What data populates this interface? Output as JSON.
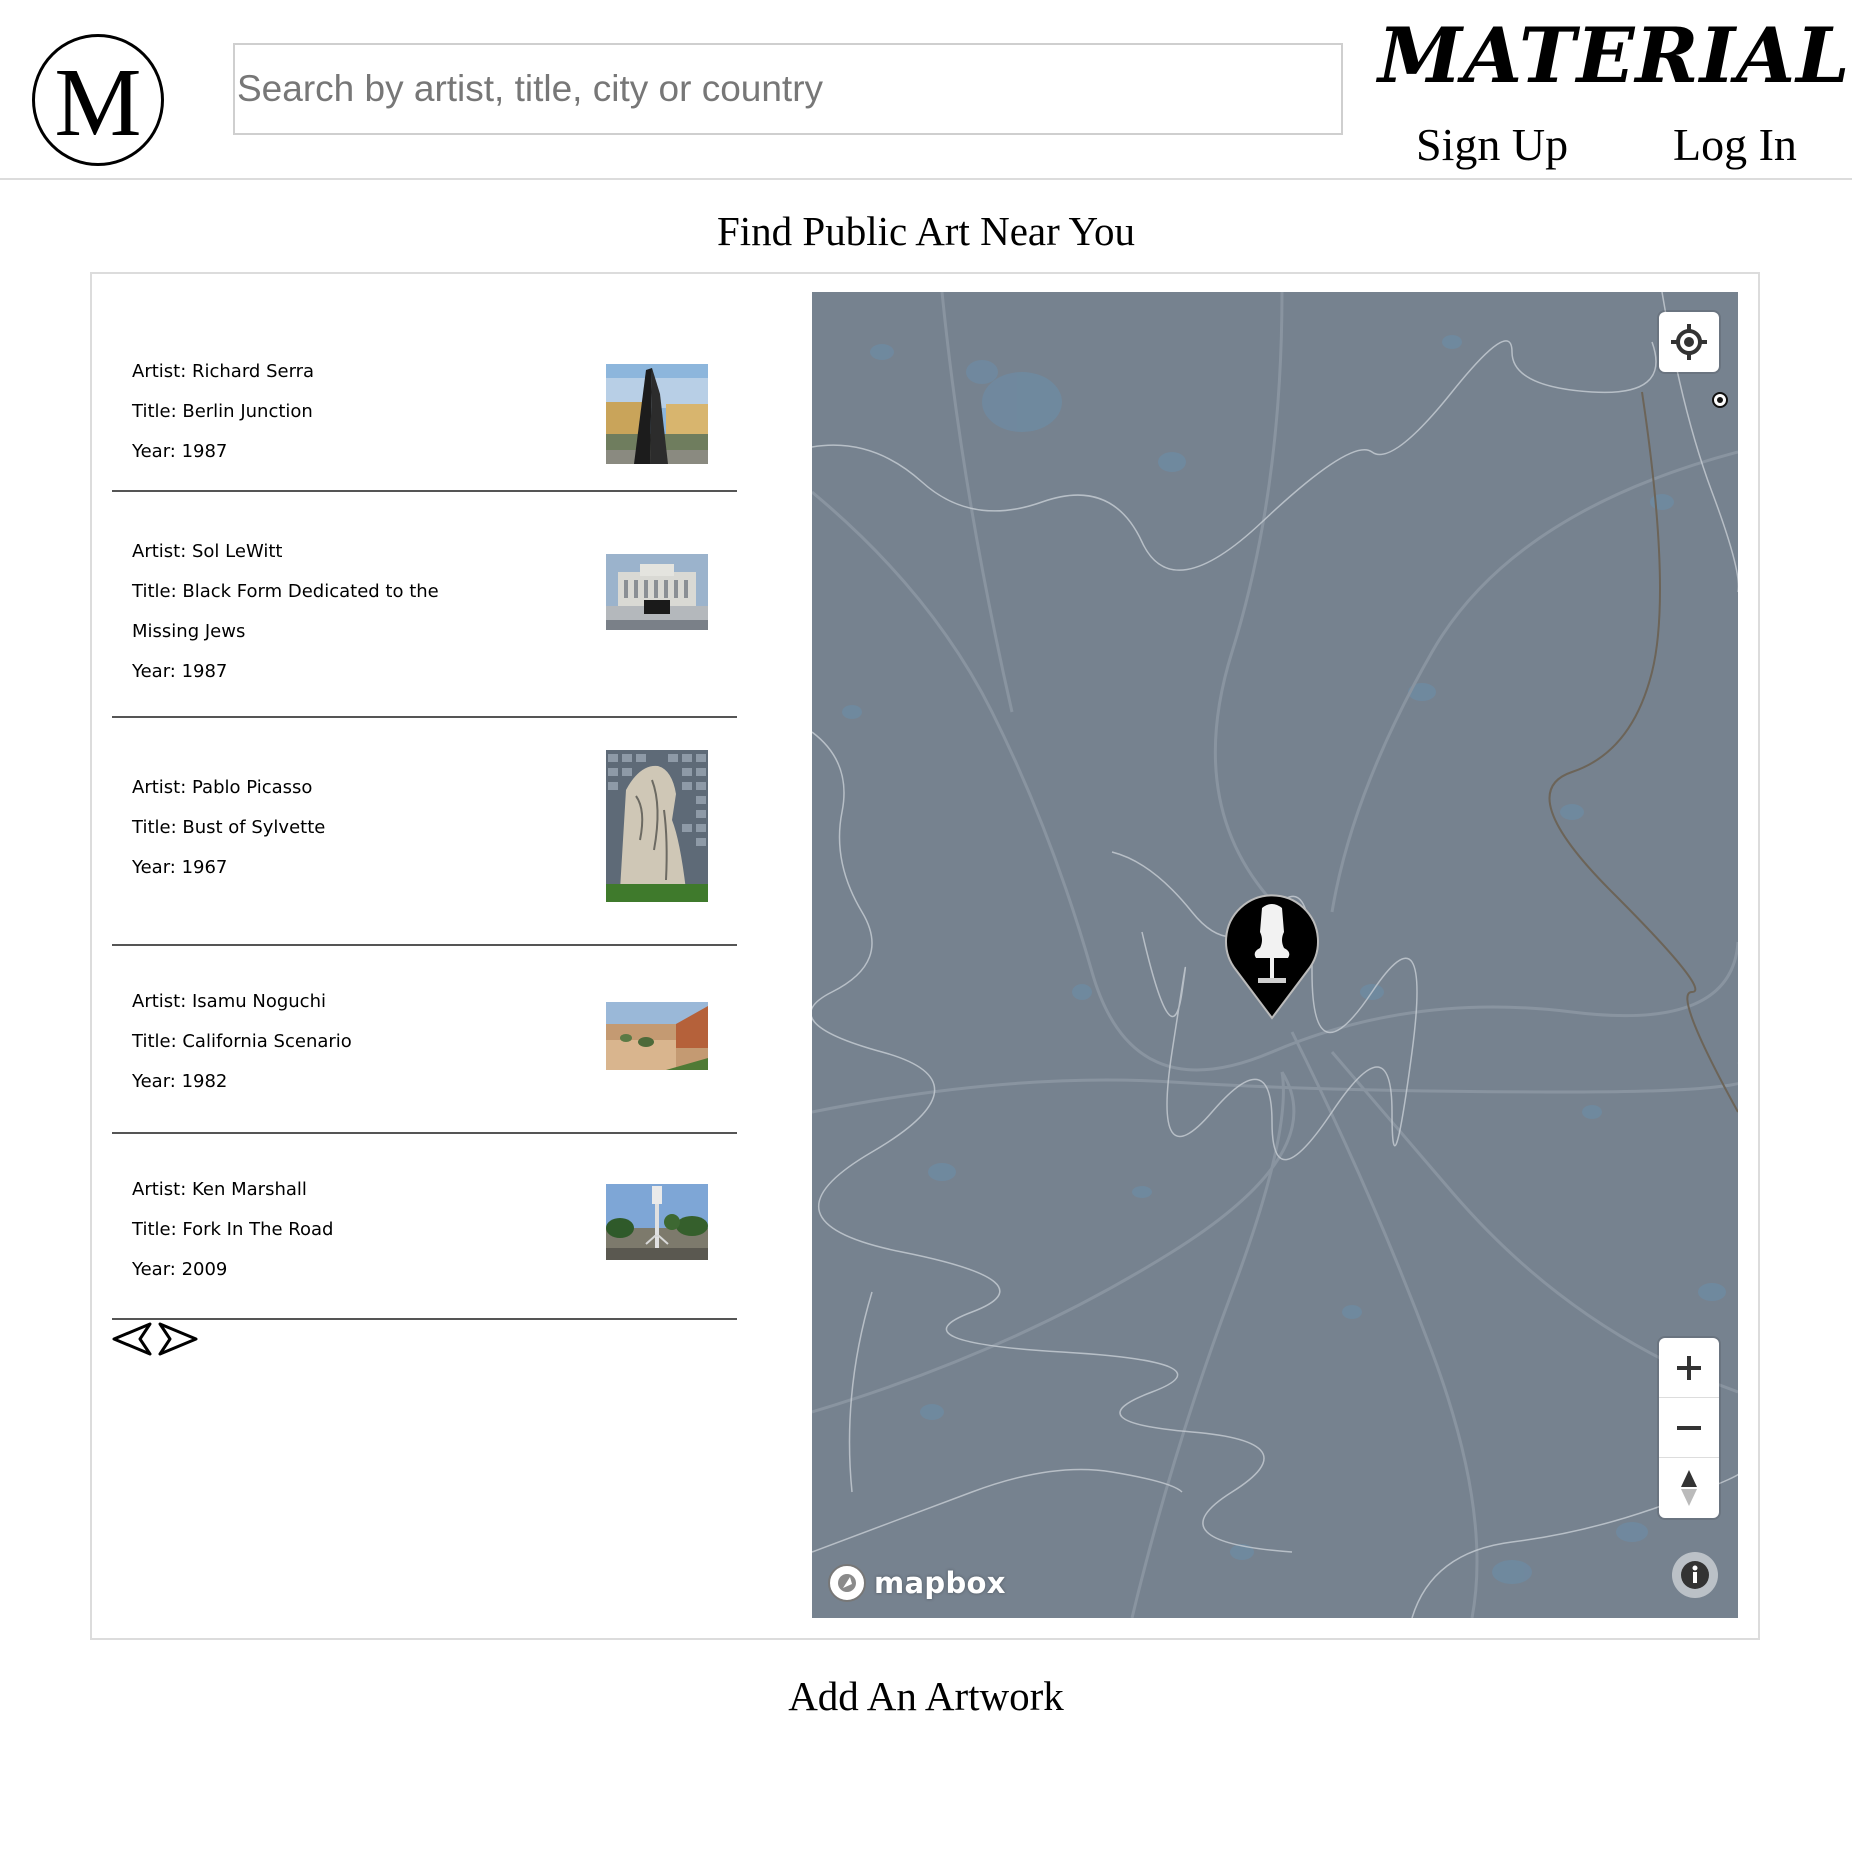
{
  "header": {
    "logo_letter": "M",
    "search_placeholder": "Search by artist, title, city or country",
    "brand": "MATERIAL",
    "signup_label": "Sign Up",
    "login_label": "Log In"
  },
  "main": {
    "find_heading": "Find Public Art Near You",
    "add_heading": "Add An Artwork"
  },
  "artworks": [
    {
      "artist": "Artist: Richard Serra",
      "title": "Title: Berlin Junction",
      "year": "Year: 1987"
    },
    {
      "artist": "Artist: Sol LeWitt",
      "title": "Title: Black Form Dedicated to the Missing Jews",
      "year": "Year: 1987"
    },
    {
      "artist": "Artist: Pablo Picasso",
      "title": "Title: Bust of Sylvette",
      "year": "Year: 1967"
    },
    {
      "artist": "Artist: Isamu Noguchi",
      "title": "Title: California Scenario",
      "year": "Year: 1982"
    },
    {
      "artist": "Artist: Ken Marshall",
      "title": "Title: Fork In The Road",
      "year": "Year: 2009"
    }
  ],
  "pagination": {
    "prev_icon": "triangle-left-icon",
    "next_icon": "triangle-right-icon"
  },
  "map": {
    "attribution": "mapbox",
    "background_color": "#76828f",
    "marker_icon": "sculpture-bust-icon",
    "controls": [
      "locate-icon",
      "zoom-in-icon",
      "zoom-out-icon",
      "compass-icon",
      "info-icon"
    ]
  }
}
